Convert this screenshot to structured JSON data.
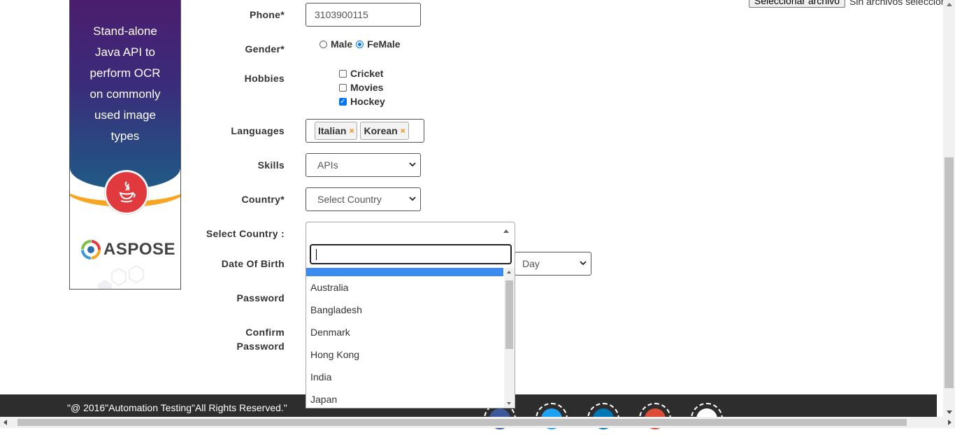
{
  "ad": {
    "text": "Stand-alone\nJava API to\nperform OCR\non commonly\nused image\ntypes",
    "brand": "ASPOSE",
    "colors": {
      "top": "#4b1d6e",
      "bottom": "#1f5a86",
      "accent": "#f6a623",
      "badge": "#e03a3e"
    }
  },
  "file_upload": {
    "button_label": "Seleccionar archivo",
    "status": "Sin archivos seleccionados"
  },
  "form": {
    "phone": {
      "label": "Phone*",
      "value": "3103900115"
    },
    "gender": {
      "label": "Gender*",
      "options": [
        "Male",
        "FeMale"
      ],
      "selected": "FeMale"
    },
    "hobbies": {
      "label": "Hobbies",
      "items": [
        {
          "label": "Cricket",
          "checked": false
        },
        {
          "label": "Movies",
          "checked": false
        },
        {
          "label": "Hockey",
          "checked": true
        }
      ]
    },
    "languages": {
      "label": "Languages",
      "selected": [
        "Italian",
        "Korean"
      ],
      "remove_glyph": "×"
    },
    "skills": {
      "label": "Skills",
      "value": "APIs"
    },
    "country": {
      "label": "Country*",
      "placeholder": "Select Country"
    },
    "select_country": {
      "label": "Select Country :",
      "options": [
        "Australia",
        "Bangladesh",
        "Denmark",
        "Hong Kong",
        "India",
        "Japan"
      ]
    },
    "dob": {
      "label": "Date Of Birth",
      "day_placeholder": "Day"
    },
    "password": {
      "label": "Password"
    },
    "confirm_password": {
      "label_line1": "Confirm",
      "label_line2": "Password"
    }
  },
  "footer": {
    "text": "\"@ 2016\"Automation Testing\"All Rights Reserved.\"",
    "social_icons": [
      "facebook-icon",
      "twitter-icon",
      "linkedin-icon",
      "googleplus-icon",
      "youtube-icon"
    ],
    "social_colors": [
      "#3b5998",
      "#1da1f2",
      "#0077b5",
      "#dd4b39",
      "#ffffff"
    ]
  },
  "accent_color": "#0075ff",
  "highlight_color": "#3b8bf0"
}
